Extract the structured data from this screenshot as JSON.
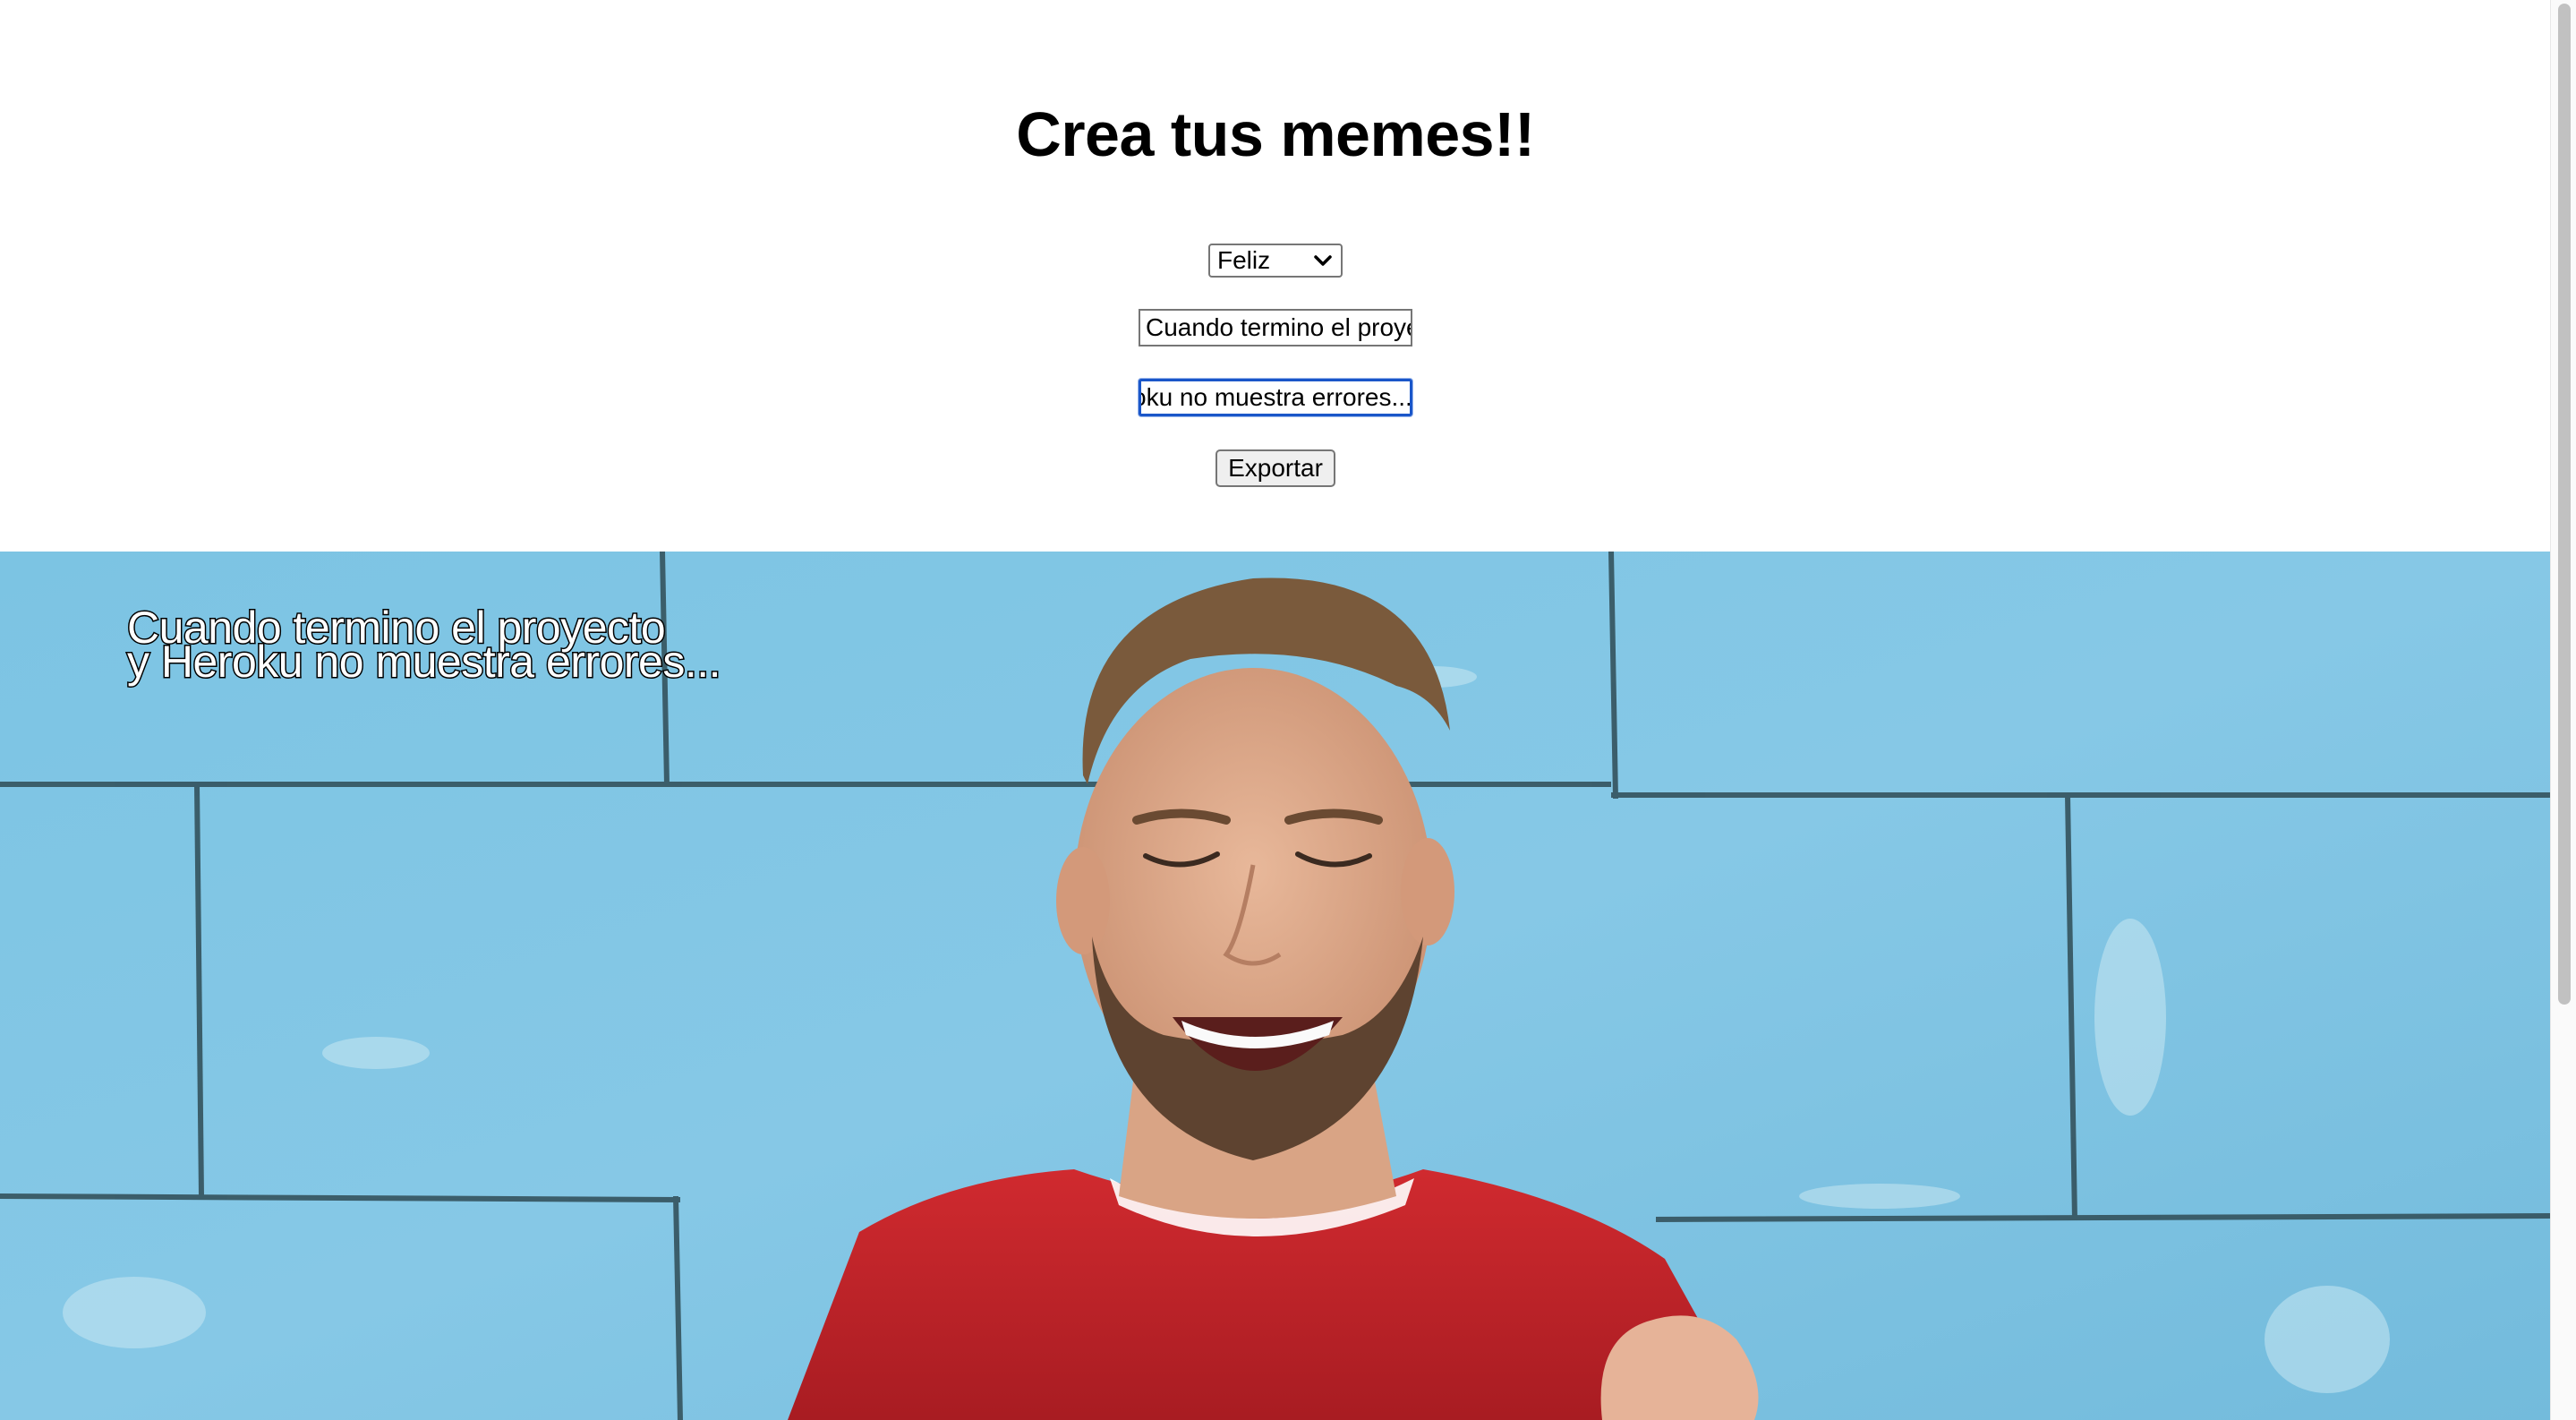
{
  "page": {
    "title": "Crea tus memes!!"
  },
  "form": {
    "mood_select": {
      "selected": "Feliz"
    },
    "line1_input": {
      "value": "Cuando termino el proyecto",
      "visible_text": "Cuando termino el proye"
    },
    "line2_input": {
      "value": "y Heroku no muestra errores...",
      "visible_text": "oku no muestra errores..."
    },
    "export_button": {
      "label": "Exportar"
    }
  },
  "meme": {
    "caption_line1": "Cuando termino el proyecto",
    "caption_line2": "y Heroku no muestra errores...",
    "colors": {
      "wall": "#7fc2e0",
      "shirt": "#c8252a",
      "caption_fill": "#ffffff",
      "caption_stroke": "#000000"
    }
  },
  "icons": {
    "select_arrow": "chevron-down-icon"
  },
  "scrollbar": {
    "visible": true
  }
}
